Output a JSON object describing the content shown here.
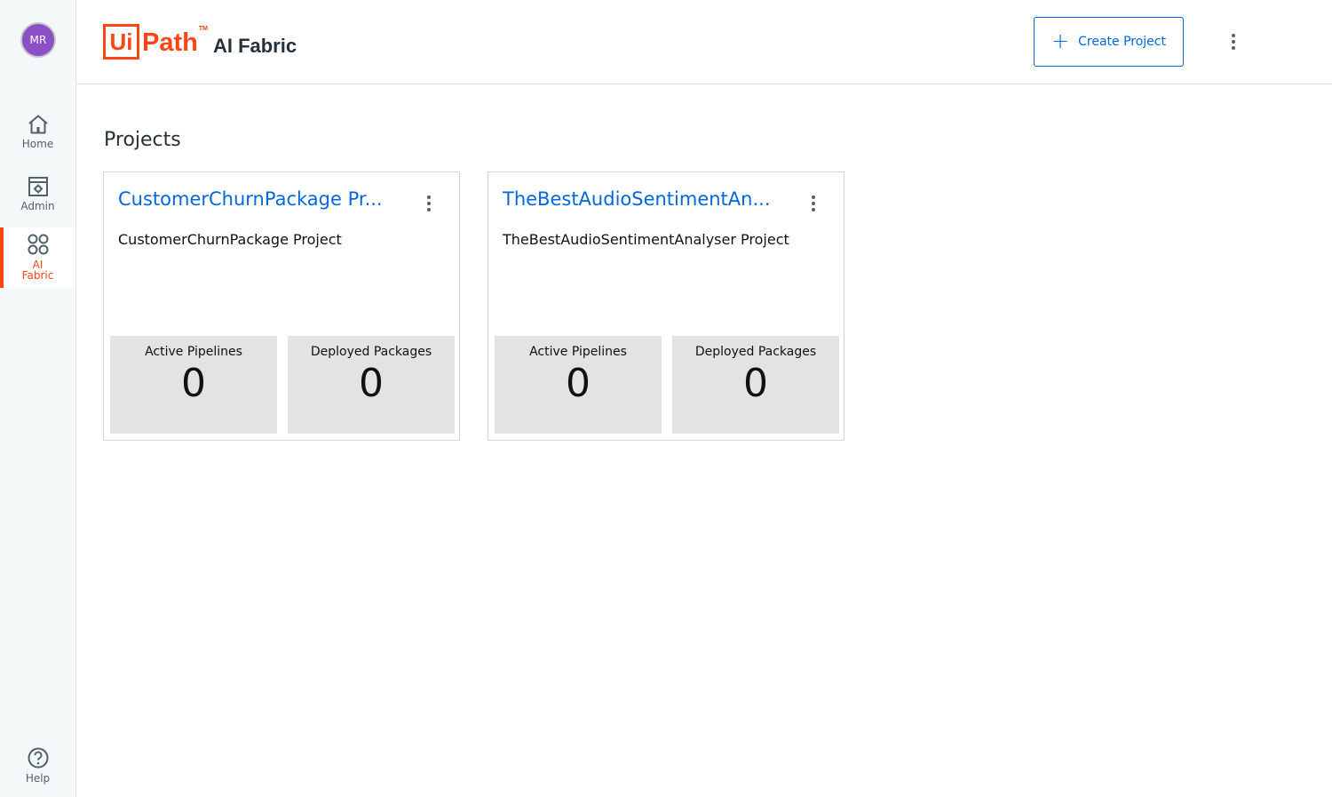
{
  "sidebar": {
    "avatar_initials": "MR",
    "items": [
      {
        "label": "Home",
        "icon": "home-icon"
      },
      {
        "label": "Admin",
        "icon": "admin-icon"
      },
      {
        "label": "AI Fabric",
        "icon": "ai-fabric-icon",
        "active": true
      },
      {
        "label": "Help",
        "icon": "help-icon"
      }
    ]
  },
  "header": {
    "logo_ui": "Ui",
    "logo_path": "Path",
    "logo_tm": "TM",
    "product_name": "AI Fabric",
    "create_button_label": "Create Project"
  },
  "main": {
    "title": "Projects",
    "projects": [
      {
        "title": "CustomerChurnPackage Pr...",
        "description": "CustomerChurnPackage Project",
        "active_pipelines_label": "Active Pipelines",
        "active_pipelines": "0",
        "deployed_packages_label": "Deployed Packages",
        "deployed_packages": "0"
      },
      {
        "title": "TheBestAudioSentimentAn...",
        "description": "TheBestAudioSentimentAnalyser Project",
        "active_pipelines_label": "Active Pipelines",
        "active_pipelines": "0",
        "deployed_packages_label": "Deployed Packages",
        "deployed_packages": "0"
      }
    ]
  },
  "colors": {
    "accent": "#fa4616",
    "link": "#0067df",
    "avatar": "#8b4fc6"
  }
}
